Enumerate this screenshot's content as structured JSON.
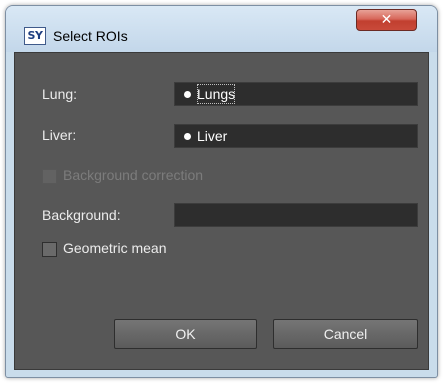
{
  "window": {
    "title": "Select ROIs",
    "logo_text": "SY",
    "close_symbol": "✕"
  },
  "form": {
    "lung": {
      "label": "Lung:",
      "value": "Lungs"
    },
    "liver": {
      "label": "Liver:",
      "value": "Liver"
    },
    "background_correction": {
      "label": "Background correction",
      "checked": false,
      "enabled": false
    },
    "background": {
      "label": "Background:",
      "value": ""
    },
    "geometric_mean": {
      "label": "Geometric mean",
      "checked": false
    }
  },
  "buttons": {
    "ok": "OK",
    "cancel": "Cancel"
  }
}
